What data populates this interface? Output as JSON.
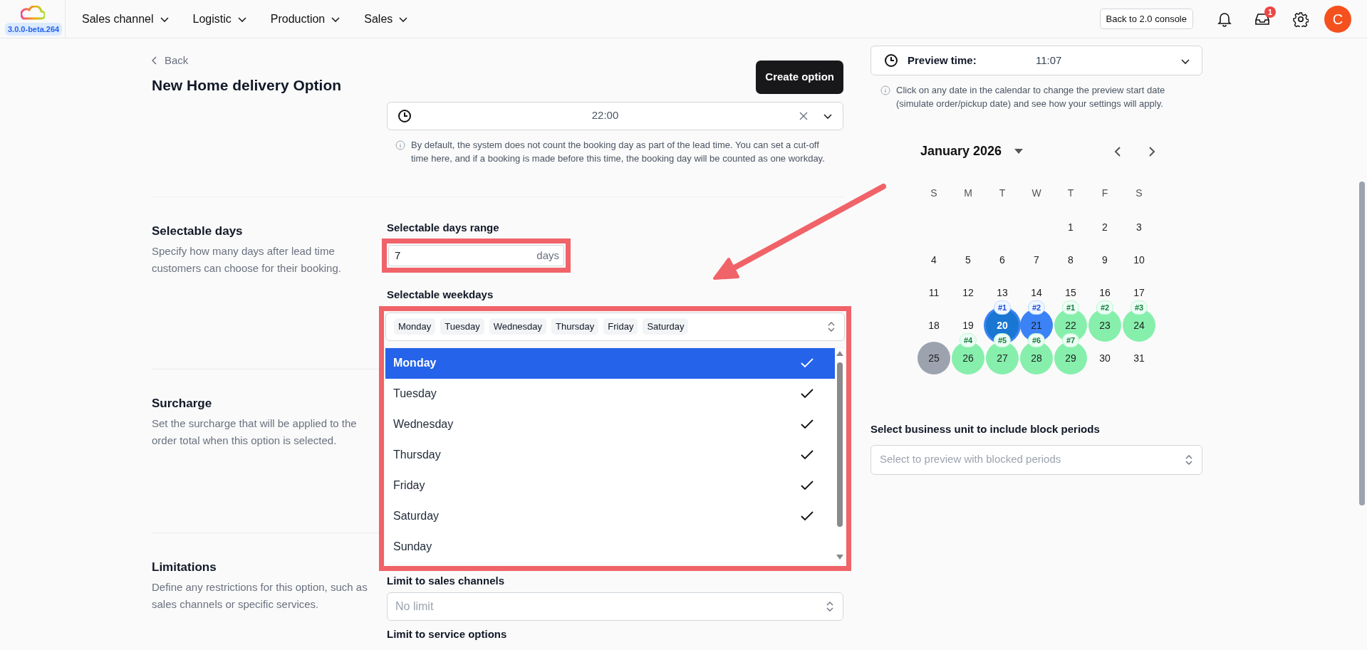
{
  "header": {
    "version": "3.0.0-beta.264",
    "nav": [
      {
        "label": "Sales channel"
      },
      {
        "label": "Logistic"
      },
      {
        "label": "Production"
      },
      {
        "label": "Sales"
      }
    ],
    "console_button": "Back to 2.0 console",
    "inbox_badge": "1",
    "avatar_initial": "C"
  },
  "page": {
    "back": "Back",
    "title": "New **Home delivery** Option",
    "create_button": "Create option"
  },
  "cutoff": {
    "value": "22:00",
    "info": "By default, the system does not count the booking day as part of the lead time. You can set a cut-off time here, and if a booking is made before this time, the booking day will be counted as one workday."
  },
  "sections": [
    {
      "title": "Selectable days",
      "description": "Specify how many days after lead time customers can choose for their booking."
    },
    {
      "title": "Surcharge",
      "description": "Set the surcharge that will be applied to the order total when this option is selected."
    },
    {
      "title": "Limitations",
      "description": "Define any restrictions for this option, such as sales channels or specific services."
    }
  ],
  "selectable_days": {
    "range_label": "Selectable days range",
    "range_value": "7",
    "range_unit": "days",
    "weekdays_label": "Selectable weekdays",
    "chips": [
      "Monday",
      "Tuesday",
      "Wednesday",
      "Thursday",
      "Friday",
      "Saturday"
    ],
    "options": [
      {
        "label": "Monday",
        "selected": true,
        "checked": true
      },
      {
        "label": "Tuesday",
        "selected": false,
        "checked": true
      },
      {
        "label": "Wednesday",
        "selected": false,
        "checked": true
      },
      {
        "label": "Thursday",
        "selected": false,
        "checked": true
      },
      {
        "label": "Friday",
        "selected": false,
        "checked": true
      },
      {
        "label": "Saturday",
        "selected": false,
        "checked": true
      },
      {
        "label": "Sunday",
        "selected": false,
        "checked": false
      }
    ]
  },
  "limitations": {
    "sales_channels_label": "Limit to sales channels",
    "sales_channels_placeholder": "No limit",
    "service_options_label": "Limit to service options"
  },
  "preview": {
    "label": "Preview time:",
    "time": "11:07",
    "info": "Click on any date in the calendar to change the preview start date (simulate order/pickup date) and see how your settings will apply."
  },
  "calendar": {
    "month": "January 2026",
    "weekdays": [
      "S",
      "M",
      "T",
      "W",
      "T",
      "F",
      "S"
    ],
    "weeks": [
      [
        {
          "day": "1",
          "kind": "plain"
        },
        {
          "day": "2",
          "kind": "plain"
        },
        {
          "day": "3",
          "kind": "plain"
        }
      ],
      [
        {
          "day": "4",
          "kind": "plain"
        },
        {
          "day": "5",
          "kind": "plain"
        },
        {
          "day": "6",
          "kind": "plain"
        },
        {
          "day": "7",
          "kind": "plain"
        },
        {
          "day": "8",
          "kind": "plain"
        },
        {
          "day": "9",
          "kind": "plain"
        },
        {
          "day": "10",
          "kind": "plain"
        }
      ],
      [
        {
          "day": "11",
          "kind": "plain"
        },
        {
          "day": "12",
          "kind": "plain"
        },
        {
          "day": "13",
          "kind": "plain"
        },
        {
          "day": "14",
          "kind": "plain"
        },
        {
          "day": "15",
          "kind": "plain"
        },
        {
          "day": "16",
          "kind": "plain"
        },
        {
          "day": "17",
          "kind": "plain"
        }
      ],
      [
        {
          "day": "18",
          "kind": "plain"
        },
        {
          "day": "19",
          "kind": "plain"
        },
        {
          "day": "20",
          "kind": "start",
          "tag": "#1"
        },
        {
          "day": "21",
          "kind": "lead",
          "tag": "#2"
        },
        {
          "day": "22",
          "kind": "selectable",
          "tag": "#1"
        },
        {
          "day": "23",
          "kind": "selectable",
          "tag": "#2"
        },
        {
          "day": "24",
          "kind": "selectable",
          "tag": "#3"
        }
      ],
      [
        {
          "day": "25",
          "kind": "blocked"
        },
        {
          "day": "26",
          "kind": "selectable",
          "tag": "#4"
        },
        {
          "day": "27",
          "kind": "selectable",
          "tag": "#5"
        },
        {
          "day": "28",
          "kind": "selectable",
          "tag": "#6"
        },
        {
          "day": "29",
          "kind": "selectable",
          "tag": "#7"
        },
        {
          "day": "30",
          "kind": "plain"
        },
        {
          "day": "31",
          "kind": "plain"
        }
      ]
    ]
  },
  "business_unit": {
    "label": "Select business unit to include block periods",
    "placeholder": "Select to preview with blocked periods"
  }
}
